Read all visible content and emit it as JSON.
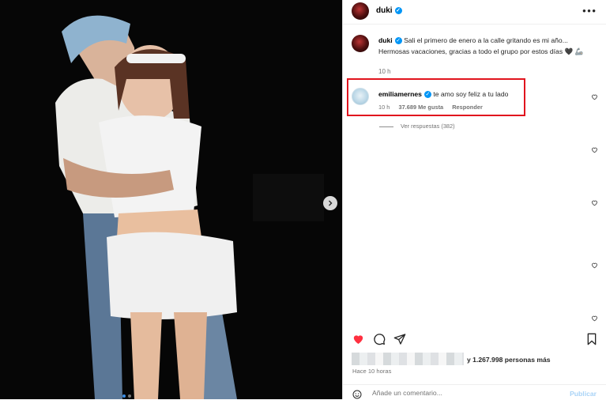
{
  "post": {
    "author": "duki",
    "more_icon": "more-icon"
  },
  "caption": {
    "username": "duki",
    "text": "Sali el primero de enero a la calle gritando es mi año... Hermosas vacaciones, gracias a todo el grupo por estos días 🖤 🦾",
    "time": "10 h"
  },
  "comment": {
    "username": "emiliamernes",
    "text": "te amo soy feliz a tu lado",
    "time": "10 h",
    "likes": "37.689 Me gusta",
    "reply_label": "Responder",
    "view_replies": "Ver respuestas (382)",
    "highlight_color": "#e1141e"
  },
  "actions": {
    "like_icon": "heart-filled-icon",
    "comment_icon": "comment-icon",
    "share_icon": "share-icon",
    "save_icon": "bookmark-icon",
    "like_color": "#ff3040"
  },
  "likes": {
    "text": "y 1.267.998 personas más"
  },
  "post_time": "Hace 10 horas",
  "add_comment": {
    "placeholder": "Añade un comentario...",
    "publish_label": "Publicar"
  },
  "colors": {
    "verified": "#0095f6",
    "publish_disabled": "#a8d3f7"
  }
}
